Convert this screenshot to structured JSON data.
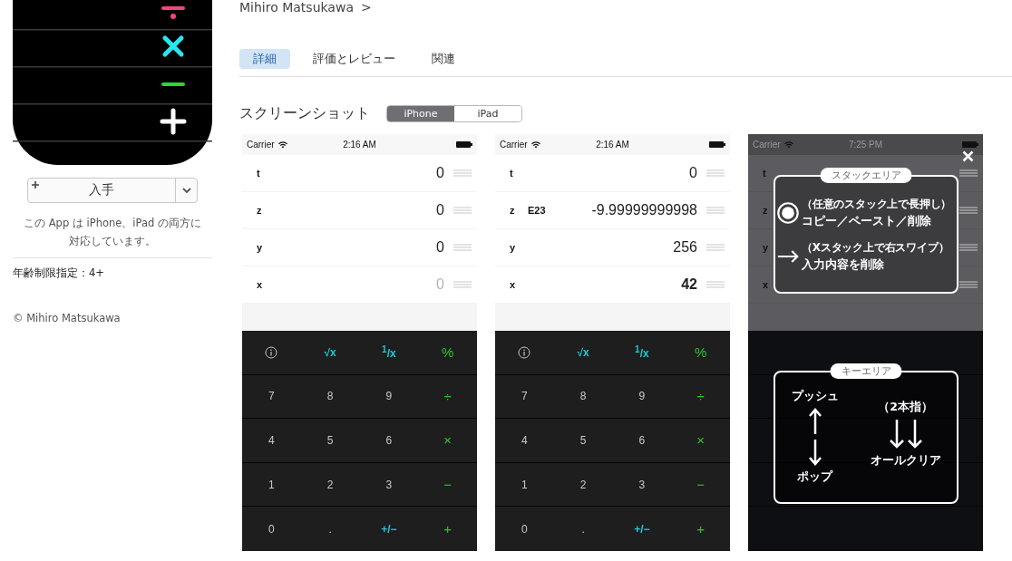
{
  "sidebar": {
    "get_button": {
      "label": "入手"
    },
    "compat": "この App は iPhone、iPad の両方に対応しています。",
    "age_rating": "年齢制限指定：4+",
    "copyright": "© Mihiro Matsukawa"
  },
  "developer": {
    "name": "Mihiro Matsukawa",
    "chevron": ">"
  },
  "tabs": [
    {
      "label": "詳細",
      "selected": true
    },
    {
      "label": "評価とレビュー",
      "selected": false
    },
    {
      "label": "関連",
      "selected": false
    }
  ],
  "screenshots": {
    "title": "スクリーンショット",
    "devices": [
      {
        "label": "iPhone",
        "selected": true
      },
      {
        "label": "iPad",
        "selected": false
      }
    ],
    "items": [
      {
        "dimmed": false,
        "status": {
          "carrier": "Carrier",
          "time": "2:16 AM"
        },
        "stack": [
          {
            "label": "t",
            "value": "0",
            "kind": "register"
          },
          {
            "label": "z",
            "value": "0",
            "kind": "register"
          },
          {
            "label": "y",
            "value": "0",
            "kind": "register"
          },
          {
            "label": "x",
            "value": "0",
            "kind": "placeholder"
          }
        ],
        "keys": [
          [
            {
              "kind": "info"
            },
            {
              "kind": "func",
              "label": "√x"
            },
            {
              "kind": "func",
              "label": "$^{1}$/x"
            },
            {
              "kind": "op",
              "label": "%"
            }
          ],
          [
            {
              "kind": "digit",
              "label": "7"
            },
            {
              "kind": "digit",
              "label": "8"
            },
            {
              "kind": "digit",
              "label": "9"
            },
            {
              "kind": "op",
              "label": "÷"
            }
          ],
          [
            {
              "kind": "digit",
              "label": "4"
            },
            {
              "kind": "digit",
              "label": "5"
            },
            {
              "kind": "digit",
              "label": "6"
            },
            {
              "kind": "op",
              "label": "×"
            }
          ],
          [
            {
              "kind": "digit",
              "label": "1"
            },
            {
              "kind": "digit",
              "label": "2"
            },
            {
              "kind": "digit",
              "label": "3"
            },
            {
              "kind": "op",
              "label": "−"
            }
          ],
          [
            {
              "kind": "digit",
              "label": "0"
            },
            {
              "kind": "digit",
              "label": "."
            },
            {
              "kind": "func",
              "label": "+/−"
            },
            {
              "kind": "op",
              "label": "+"
            }
          ]
        ]
      },
      {
        "dimmed": false,
        "status": {
          "carrier": "Carrier",
          "time": "2:16 AM"
        },
        "stack": [
          {
            "label": "t",
            "value": "0",
            "kind": "register"
          },
          {
            "label": "z",
            "exponent": "E23",
            "value": "-9.99999999998",
            "kind": "register"
          },
          {
            "label": "y",
            "value": "256",
            "kind": "register"
          },
          {
            "label": "x",
            "value": "42",
            "kind": "input"
          }
        ],
        "keys": [
          [
            {
              "kind": "info"
            },
            {
              "kind": "func",
              "label": "√x"
            },
            {
              "kind": "func",
              "label": "$^{1}$/x"
            },
            {
              "kind": "op",
              "label": "%"
            }
          ],
          [
            {
              "kind": "digit",
              "label": "7"
            },
            {
              "kind": "digit",
              "label": "8"
            },
            {
              "kind": "digit",
              "label": "9"
            },
            {
              "kind": "op",
              "label": "÷"
            }
          ],
          [
            {
              "kind": "digit",
              "label": "4"
            },
            {
              "kind": "digit",
              "label": "5"
            },
            {
              "kind": "digit",
              "label": "6"
            },
            {
              "kind": "op",
              "label": "×"
            }
          ],
          [
            {
              "kind": "digit",
              "label": "1"
            },
            {
              "kind": "digit",
              "label": "2"
            },
            {
              "kind": "digit",
              "label": "3"
            },
            {
              "kind": "op",
              "label": "−"
            }
          ],
          [
            {
              "kind": "digit",
              "label": "0"
            },
            {
              "kind": "digit",
              "label": "."
            },
            {
              "kind": "func",
              "label": "+/−"
            },
            {
              "kind": "op",
              "label": "+"
            }
          ]
        ]
      },
      {
        "dimmed": true,
        "status": {
          "carrier": "Carrier",
          "time": "7:25 PM"
        },
        "stack": [
          {
            "label": "t"
          },
          {
            "label": "z"
          },
          {
            "label": "y"
          },
          {
            "label": "x"
          }
        ],
        "keys": [
          [
            {
              "kind": "hidden"
            },
            {
              "kind": "hidden"
            },
            {
              "kind": "hidden"
            },
            {
              "kind": "hidden"
            }
          ],
          [
            {
              "kind": "hidden"
            },
            {
              "kind": "hidden"
            },
            {
              "kind": "hidden"
            },
            {
              "kind": "hidden"
            }
          ],
          [
            {
              "kind": "hidden"
            },
            {
              "kind": "hidden"
            },
            {
              "kind": "hidden"
            },
            {
              "kind": "hidden"
            }
          ],
          [
            {
              "kind": "hidden"
            },
            {
              "kind": "hidden"
            },
            {
              "kind": "hidden"
            },
            {
              "kind": "hidden"
            }
          ],
          [
            {
              "kind": "hidden"
            },
            {
              "kind": "hidden"
            },
            {
              "kind": "hidden"
            },
            {
              "kind": "hidden"
            }
          ]
        ],
        "overlay": {
          "stack_panel": {
            "title": "スタックエリア",
            "items": [
              {
                "kind": "long-press",
                "hint": "（任意のスタック上で長押し）",
                "action": "コピー／ペースト／削除"
              },
              {
                "kind": "swipe-right",
                "hint": "（Xスタック上で右スワイプ）",
                "action": "入力内容を削除"
              }
            ]
          },
          "key_panel": {
            "title": "キーエリア",
            "push": "プッシュ",
            "pop": "ポップ",
            "fingers": "（2本指）",
            "clear": "オールクリア"
          }
        }
      }
    ]
  }
}
